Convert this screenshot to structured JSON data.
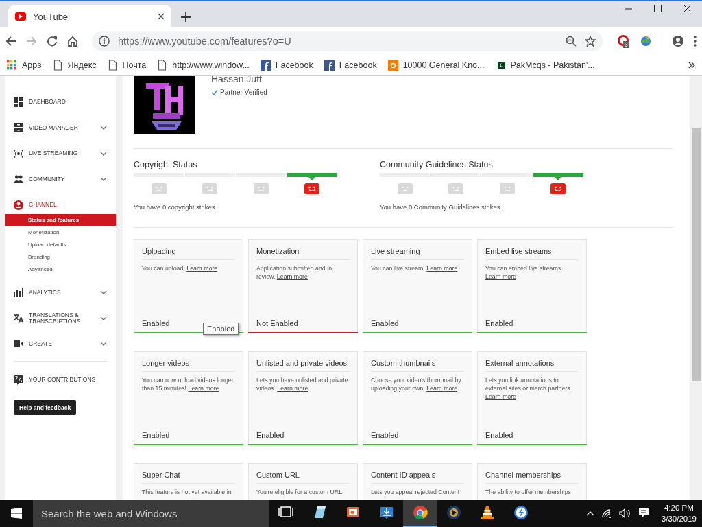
{
  "browser": {
    "tab": {
      "title": "YouTube"
    },
    "url": "https://www.youtube.com/features?o=U",
    "extension_badge": "3",
    "bookmarks": [
      {
        "kind": "apps",
        "label": "Apps"
      },
      {
        "kind": "page",
        "label": "Яндекс"
      },
      {
        "kind": "page",
        "label": "Почта"
      },
      {
        "kind": "page",
        "label": "http://www.window..."
      },
      {
        "kind": "facebook",
        "label": "Facebook"
      },
      {
        "kind": "facebook",
        "label": "Facebook"
      },
      {
        "kind": "blogger",
        "label": "10000 General Kno..."
      },
      {
        "kind": "flag",
        "label": "PakMcqs - Pakistan'..."
      }
    ]
  },
  "sidebar": {
    "items": [
      {
        "kind": "dashboard",
        "label": "DASHBOARD",
        "expandable": false,
        "selected": false
      },
      {
        "kind": "video-manager",
        "label": "VIDEO MANAGER",
        "expandable": true,
        "selected": false
      },
      {
        "kind": "live",
        "label": "LIVE STREAMING",
        "expandable": true,
        "selected": false
      },
      {
        "kind": "community",
        "label": "COMMUNITY",
        "expandable": true,
        "selected": false
      },
      {
        "kind": "channel",
        "label": "CHANNEL",
        "expandable": false,
        "selected": true,
        "children": [
          {
            "label": "Status and features",
            "selected": true
          },
          {
            "label": "Monetization",
            "selected": false
          },
          {
            "label": "Upload defaults",
            "selected": false
          },
          {
            "label": "Branding",
            "selected": false
          },
          {
            "label": "Advanced",
            "selected": false
          }
        ]
      },
      {
        "kind": "analytics",
        "label": "ANALYTICS",
        "expandable": true,
        "selected": false
      },
      {
        "kind": "translate",
        "label": "TRANSLATIONS & TRANSCRIPTIONS",
        "expandable": true,
        "selected": false
      },
      {
        "kind": "create",
        "label": "CREATE",
        "expandable": true,
        "selected": false
      }
    ],
    "contributions": {
      "label": "YOUR CONTRIBUTIONS"
    },
    "help_button": "Help and feedback"
  },
  "channel": {
    "name": "Hassan Jutt",
    "verified": "Partner Verified"
  },
  "strikes": [
    {
      "title": "Copyright Status",
      "message": "You have 0 copyright strikes.",
      "faces": [
        {
          "kind": "sad",
          "selected": false
        },
        {
          "kind": "meh",
          "selected": false
        },
        {
          "kind": "neutral",
          "selected": false
        },
        {
          "kind": "happy",
          "selected": true
        }
      ]
    },
    {
      "title": "Community Guidelines Status",
      "message": "You have 0 Community Guidelines strikes.",
      "faces": [
        {
          "kind": "sad",
          "selected": false
        },
        {
          "kind": "meh",
          "selected": false
        },
        {
          "kind": "neutral",
          "selected": false
        },
        {
          "kind": "happy",
          "selected": true
        }
      ]
    }
  ],
  "features": [
    {
      "title": "Uploading",
      "description": "You can upload!",
      "link": "Learn more",
      "status": "Enabled",
      "enabled": true,
      "tooltip": "Enabled"
    },
    {
      "title": "Monetization",
      "description": "Application submitted and in review.",
      "link": "Learn more",
      "status": "Not Enabled",
      "enabled": false
    },
    {
      "title": "Live streaming",
      "description": "You can live stream.",
      "link": "Learn more",
      "status": "Enabled",
      "enabled": true
    },
    {
      "title": "Embed live streams",
      "description": "You can embed live streams.",
      "link": "Learn more",
      "status": "Enabled",
      "enabled": true
    },
    {
      "title": "Longer videos",
      "description": "You can now upload videos longer than 15 minutes!",
      "link": "Learn more",
      "status": "Enabled",
      "enabled": true
    },
    {
      "title": "Unlisted and private videos",
      "description": "Lets you have unlisted and private videos.",
      "link": "Learn more",
      "status": "Enabled",
      "enabled": true
    },
    {
      "title": "Custom thumbnails",
      "description": "Choose your video's thumbnail by uploading your own.",
      "link": "Learn more",
      "status": "Enabled",
      "enabled": true
    },
    {
      "title": "External annotations",
      "description": "Lets you link annotations to external sites or merch partners.",
      "link": "Learn more",
      "status": "Enabled",
      "enabled": true
    },
    {
      "title": "Super Chat",
      "description": "This feature is not yet available in"
    },
    {
      "title": "Custom URL",
      "description": "You're eligible for a custom URL."
    },
    {
      "title": "Content ID appeals",
      "description": "Lets you appeal rejected Content"
    },
    {
      "title": "Channel memberships",
      "description": "The ability to offer memberships"
    }
  ],
  "taskbar": {
    "search_placeholder": "Search the web and Windows",
    "apps": [
      {
        "kind": "task-view",
        "selected": false
      },
      {
        "kind": "notepad",
        "selected": false
      },
      {
        "kind": "presentation",
        "selected": false
      },
      {
        "kind": "download",
        "selected": false
      },
      {
        "kind": "chrome",
        "selected": true
      },
      {
        "kind": "media",
        "selected": false
      },
      {
        "kind": "cone",
        "selected": false
      },
      {
        "kind": "round",
        "selected": false
      }
    ],
    "time": "4:20 PM",
    "date": "3/30/2019"
  }
}
